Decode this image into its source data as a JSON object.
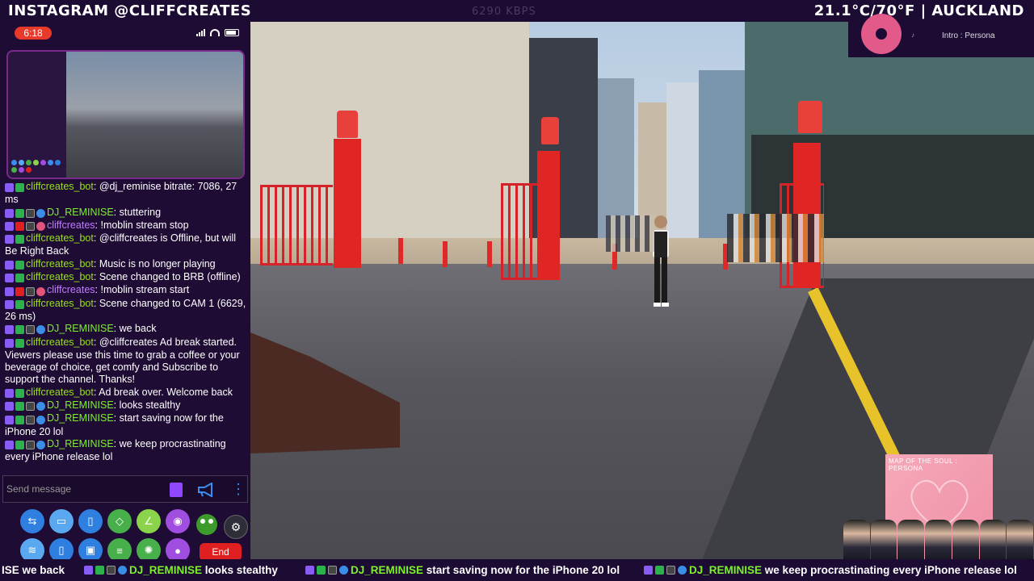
{
  "header": {
    "instagram": "INSTAGRAM @CLIFFCREATES",
    "bitrate": "6290 KBPS",
    "weather": "21.1°C/70°F | AUCKLAND"
  },
  "phone": {
    "time": "6:18"
  },
  "chat": {
    "messages": [
      {
        "user": "cliffcreates_bot",
        "sep": ": ",
        "text": "@dj_reminise bitrate: 7086, 27 ms"
      },
      {
        "user": "DJ_REMINISE",
        "sep": ": ",
        "text": "stuttering"
      },
      {
        "user": "cliffcreates",
        "sep": ": ",
        "text": "!moblin stream stop"
      },
      {
        "user": "cliffcreates_bot",
        "sep": ": ",
        "text": "@cliffcreates is Offline, but will Be Right Back"
      },
      {
        "user": "cliffcreates_bot",
        "sep": ": ",
        "text": "Music is no longer playing"
      },
      {
        "user": "cliffcreates_bot",
        "sep": ": ",
        "text": "Scene changed to BRB (offline)"
      },
      {
        "user": "cliffcreates",
        "sep": ": ",
        "text": "!moblin stream start"
      },
      {
        "user": "cliffcreates_bot",
        "sep": ": ",
        "text": "Scene changed to CAM 1 (6629, 26 ms)"
      },
      {
        "user": "DJ_REMINISE",
        "sep": ": ",
        "text": "we back"
      },
      {
        "user": "cliffcreates_bot",
        "sep": ": ",
        "text": "@cliffcreates Ad break started. Viewers please use this time to grab a coffee or your beverage of choice, get comfy and Subscribe to support the channel. Thanks!"
      },
      {
        "user": "cliffcreates_bot",
        "sep": ": ",
        "text": "Ad break over. Welcome back"
      },
      {
        "user": "DJ_REMINISE",
        "sep": ": ",
        "text": "looks stealthy"
      },
      {
        "user": "DJ_REMINISE",
        "sep": ": ",
        "text": "start saving now for the iPhone 20 lol"
      },
      {
        "user": "DJ_REMINISE",
        "sep": ": ",
        "text": "we keep procrastinating every iPhone release lol"
      }
    ],
    "input_placeholder": "Send message"
  },
  "controls": {
    "end_label": "End"
  },
  "now_playing": {
    "title": "Intro : Persona",
    "album_text": "MAP OF THE SOUL : PERSONA"
  },
  "ticker": {
    "t1": "ISE we back",
    "u2": "DJ_REMINISE",
    "t2": "looks stealthy",
    "u3": "DJ_REMINISE",
    "t3": "start saving now for the iPhone 20 lol",
    "u4": "DJ_REMINISE",
    "t4": "we keep procrastinating every iPhone release lol"
  },
  "colors": {
    "bot": "#9adf1e",
    "dj": "#7cf02a",
    "streamer": "#c07cff",
    "end": "#e02020"
  }
}
